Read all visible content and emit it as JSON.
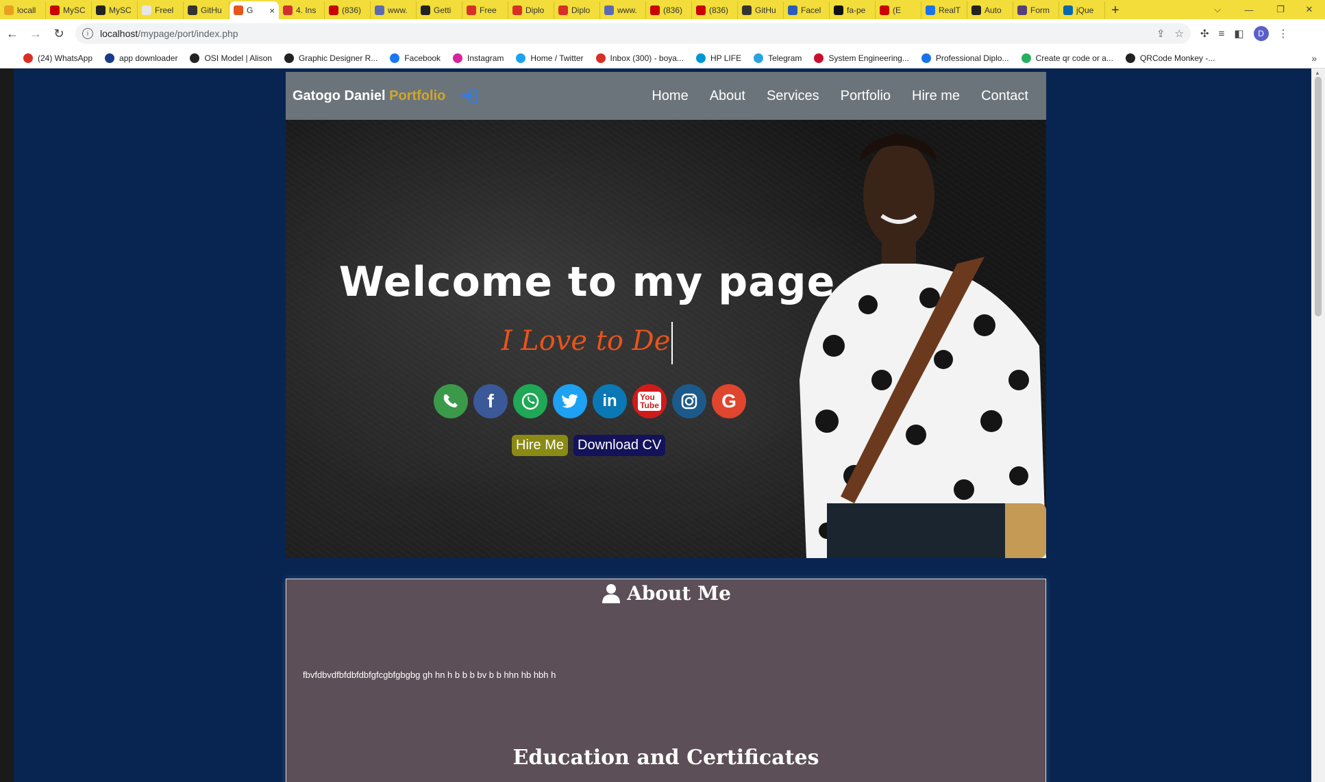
{
  "browser": {
    "tabs": [
      {
        "label": "locall",
        "fav": "#e8a020"
      },
      {
        "label": "MySC",
        "fav": "#cc0000"
      },
      {
        "label": "MySC",
        "fav": "#222222"
      },
      {
        "label": "Freel",
        "fav": "#e6e6e6"
      },
      {
        "label": "GitHu",
        "fav": "#333333"
      },
      {
        "label": "G",
        "fav": "#e8541a",
        "active": true
      },
      {
        "label": "4. Ins",
        "fav": "#d32f2f"
      },
      {
        "label": "(836)",
        "fav": "#cc0000"
      },
      {
        "label": "www.",
        "fav": "#5a6bb3"
      },
      {
        "label": "Getti",
        "fav": "#222222"
      },
      {
        "label": "Free",
        "fav": "#d93025"
      },
      {
        "label": "Diplo",
        "fav": "#d93025"
      },
      {
        "label": "Diplo",
        "fav": "#d93025"
      },
      {
        "label": "www.",
        "fav": "#5a6bb3"
      },
      {
        "label": "(836)",
        "fav": "#cc0000"
      },
      {
        "label": "(836)",
        "fav": "#cc0000"
      },
      {
        "label": "GitHu",
        "fav": "#333333"
      },
      {
        "label": "Facel",
        "fav": "#2b5cbb"
      },
      {
        "label": "fa-pe",
        "fav": "#111111"
      },
      {
        "label": "(E",
        "fav": "#cc0000"
      },
      {
        "label": "RealT",
        "fav": "#1a73e8"
      },
      {
        "label": "Auto",
        "fav": "#222222"
      },
      {
        "label": "Form",
        "fav": "#563d7c"
      },
      {
        "label": "jQue",
        "fav": "#0769ad"
      }
    ],
    "active_close": "×",
    "new_tab": "+",
    "url_host": "localhost",
    "url_path": "/mypage/port/index.php",
    "profile_initial": "D",
    "bookmarks": [
      {
        "label": "(24) WhatsApp",
        "color": "#d93025"
      },
      {
        "label": "app downloader",
        "color": "#1a3a8a"
      },
      {
        "label": "OSI Model | Alison",
        "color": "#222222"
      },
      {
        "label": "Graphic Designer R...",
        "color": "#222222"
      },
      {
        "label": "Facebook",
        "color": "#1877f2"
      },
      {
        "label": "Instagram",
        "color": "#d6249f"
      },
      {
        "label": "Home / Twitter",
        "color": "#1da1f2"
      },
      {
        "label": "Inbox (300) - boya...",
        "color": "#d93025"
      },
      {
        "label": "HP LIFE",
        "color": "#0096d6"
      },
      {
        "label": "Telegram",
        "color": "#2aa3df"
      },
      {
        "label": "System Engineering...",
        "color": "#c8102e"
      },
      {
        "label": "Professional Diplo...",
        "color": "#1a73e8"
      },
      {
        "label": "Create qr code or a...",
        "color": "#27ae60"
      },
      {
        "label": "QRCode Monkey -...",
        "color": "#222222"
      }
    ]
  },
  "site": {
    "brand_name": "Gatogo Daniel",
    "brand_accent": "Portfolio",
    "menu": [
      "Home",
      "About",
      "Services",
      "Portfolio",
      "Hire me",
      "Contact"
    ],
    "hero_title": "Welcome to my page",
    "hero_typed": "I Love to De",
    "socials": [
      {
        "name": "phone-icon",
        "color": "#3a9a4a"
      },
      {
        "name": "facebook-icon",
        "color": "#3b5998"
      },
      {
        "name": "whatsapp-icon",
        "color": "#1fa855"
      },
      {
        "name": "twitter-icon",
        "color": "#1da1f2"
      },
      {
        "name": "linkedin-icon",
        "color": "#0a78b5"
      },
      {
        "name": "youtube-icon",
        "color": "#d11a1a"
      },
      {
        "name": "instagram-icon",
        "color": "#1b5a8a"
      },
      {
        "name": "google-icon",
        "color": "#e0452e"
      }
    ],
    "hire_btn": "Hire Me",
    "cv_btn": "Download CV",
    "about_title": "About Me",
    "about_text": "fbvfdbvdfbfdbfdbfgfcgbfgbgbg gh hn h b b b bv b b hhn hb hbh h",
    "education_title": "Education and Certificates"
  }
}
